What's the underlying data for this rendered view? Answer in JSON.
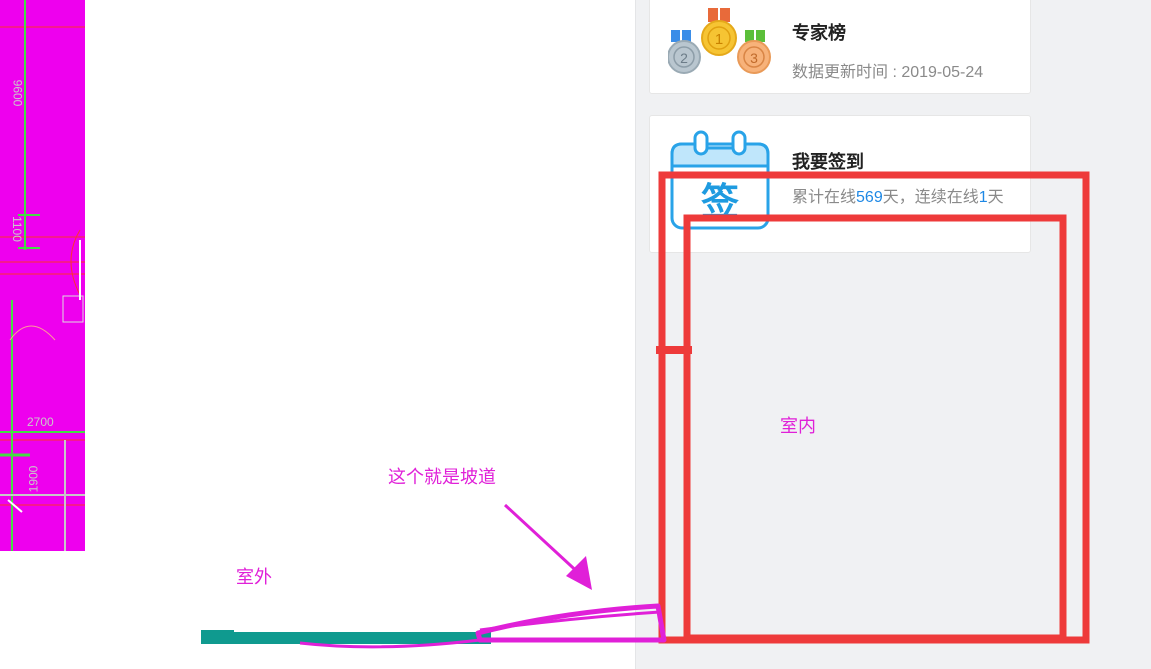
{
  "expert_card": {
    "title": "专家榜",
    "update_text": "数据更新时间 : 2019-05-24",
    "icon": "medal-trophy-icon"
  },
  "sign_card": {
    "title": "我要签到",
    "text_prefix": "累计在线",
    "online_days": "569",
    "text_middle": "天，连续在线",
    "streak_days": "1",
    "text_suffix": "天",
    "icon": "calendar-sign-icon",
    "icon_glyph": "签"
  },
  "drawing": {
    "dims": [
      "9600",
      "1100",
      "2700",
      "1900"
    ]
  },
  "annotations": {
    "ramp": "这个就是坡道",
    "outdoor": "室外",
    "indoor": "室内"
  },
  "colors": {
    "annotation": "#e020d8",
    "frame": "#ee3a3a",
    "floor": "#0f9a8f",
    "cad_background": "#ee00ee",
    "accent": "#1e88e5"
  }
}
